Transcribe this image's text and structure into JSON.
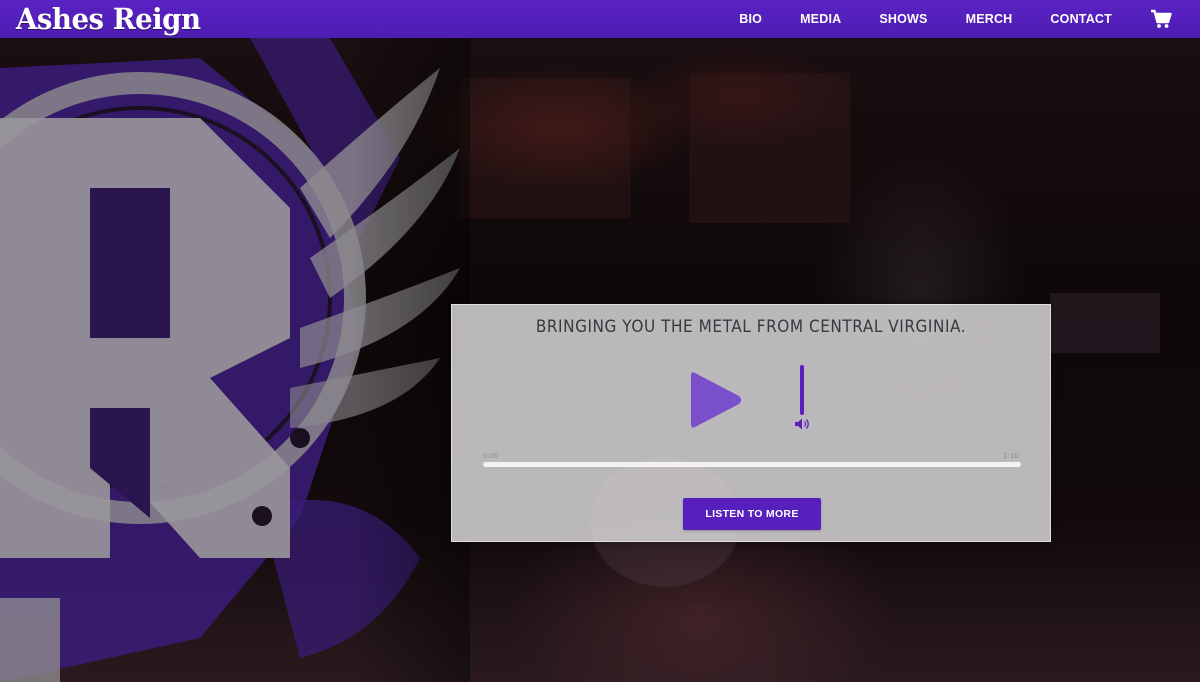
{
  "header": {
    "logo_text": "Ashes Reign",
    "nav": [
      {
        "label": "BIO"
      },
      {
        "label": "MEDIA"
      },
      {
        "label": "SHOWS"
      },
      {
        "label": "MERCH"
      },
      {
        "label": "CONTACT"
      }
    ],
    "cart_icon": "shopping-cart-icon"
  },
  "hero": {
    "tagline": "BRINGING YOU THE METAL FROM CENTRAL VIRGINIA.",
    "player": {
      "play_icon": "play-icon",
      "volume_icon": "speaker-icon",
      "volume_level": 1.0,
      "current_time": "0:00",
      "total_time": "1:10",
      "progress": 0
    },
    "cta_label": "LISTEN TO MORE"
  },
  "colors": {
    "brand_purple": "#5720bd",
    "card_bg": "#d7d5d8",
    "text_dark": "#3b383d"
  }
}
